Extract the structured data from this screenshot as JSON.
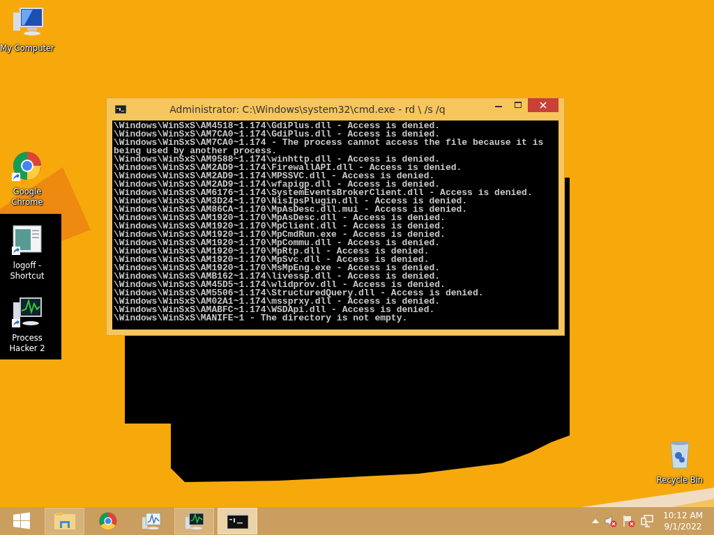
{
  "desktop_icons": [
    {
      "label": "My Computer",
      "kind": "computer",
      "shortcut": false
    },
    {
      "label": "Google Chrome",
      "kind": "chrome",
      "shortcut": true
    },
    {
      "label": "logoff - Shortcut",
      "kind": "document",
      "shortcut": true
    },
    {
      "label": "Process Hacker 2",
      "kind": "monitor-graph",
      "shortcut": true
    },
    {
      "label": "Recycle Bin",
      "kind": "bin",
      "shortcut": false
    }
  ],
  "window": {
    "title": "Administrator: C:\\Windows\\system32\\cmd.exe - rd \\ /s /q",
    "lines": [
      "\\Windows\\WinSxS\\AM4518~1.174\\GdiPlus.dll - Access is denied.",
      "\\Windows\\WinSxS\\AM7CA0~1.174\\GdiPlus.dll - Access is denied.",
      "\\Windows\\WinSxS\\AM7CA0~1.174 - The process cannot access the file because it is",
      "being used by another process.",
      "\\Windows\\WinSxS\\AM9588~1.174\\winhttp.dll - Access is denied.",
      "\\Windows\\WinSxS\\AM2AD9~1.174\\FirewallAPI.dll - Access is denied.",
      "\\Windows\\WinSxS\\AM2AD9~1.174\\MPSSVC.dll - Access is denied.",
      "\\Windows\\WinSxS\\AM2AD9~1.174\\wfapigp.dll - Access is denied.",
      "\\Windows\\WinSxS\\AM6176~1.174\\SystemEventsBrokerClient.dll - Access is denied.",
      "\\Windows\\WinSxS\\AM3D24~1.170\\NisIpsPlugin.dll - Access is denied.",
      "\\Windows\\WinSxS\\AM86CA~1.170\\MpAsDesc.dll.mui - Access is denied.",
      "\\Windows\\WinSxS\\AM1920~1.170\\MpAsDesc.dll - Access is denied.",
      "\\Windows\\WinSxS\\AM1920~1.170\\MpClient.dll - Access is denied.",
      "\\Windows\\WinSxS\\AM1920~1.170\\MpCmdRun.exe - Access is denied.",
      "\\Windows\\WinSxS\\AM1920~1.170\\MpCommu.dll - Access is denied.",
      "\\Windows\\WinSxS\\AM1920~1.170\\MpRtp.dll - Access is denied.",
      "\\Windows\\WinSxS\\AM1920~1.170\\MpSvc.dll - Access is denied.",
      "\\Windows\\WinSxS\\AM1920~1.170\\MsMpEng.exe - Access is denied.",
      "\\Windows\\WinSxS\\AMB162~1.174\\livessp.dll - Access is denied.",
      "\\Windows\\WinSxS\\AM45D5~1.174\\wlidprov.dll - Access is denied.",
      "\\Windows\\WinSxS\\AM5506~1.174\\StructuredQuery.dll - Access is denied.",
      "\\Windows\\WinSxS\\AM02A1~1.174\\mssprxy.dll - Access is denied.",
      "\\Windows\\WinSxS\\AMABFC~1.174\\WSDApi.dll - Access is denied.",
      "\\Windows\\WinSxS\\MANIFE~1 - The directory is not empty."
    ]
  },
  "taskbar": {
    "items": [
      {
        "kind": "start",
        "running": false,
        "selected": false
      },
      {
        "kind": "folder",
        "running": true,
        "selected": false
      },
      {
        "kind": "chrome",
        "running": false,
        "selected": false
      },
      {
        "kind": "chart-monitor",
        "running": false,
        "selected": false
      },
      {
        "kind": "monitor-graph",
        "running": true,
        "selected": false
      },
      {
        "kind": "console",
        "running": true,
        "selected": true
      }
    ]
  },
  "tray": {
    "time": "10:12 AM",
    "date": "9/1/2022"
  }
}
